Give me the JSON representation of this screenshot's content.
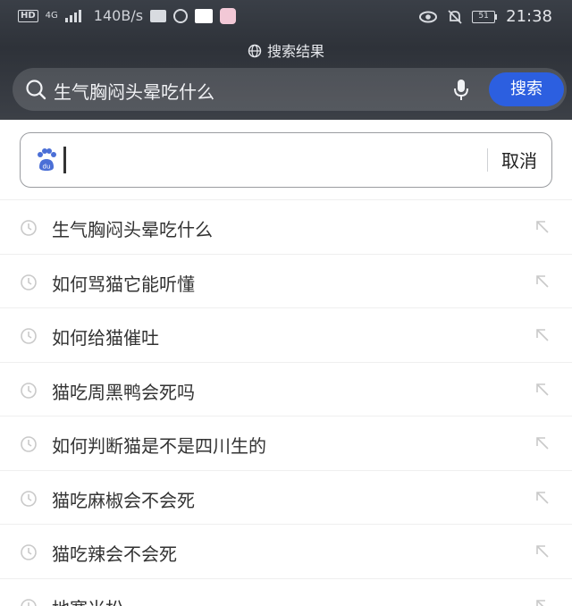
{
  "status_bar": {
    "network_hd": "HD",
    "network_gen": "4G",
    "speed": "140B/s",
    "battery": "51",
    "time": "21:38"
  },
  "page": {
    "results_label": "搜索结果",
    "search_query": "生气胸闷头晕吃什么",
    "search_button": "搜索"
  },
  "input": {
    "value": "",
    "cancel_label": "取消"
  },
  "history": [
    "生气胸闷头晕吃什么",
    "如何骂猫它能听懂",
    "如何给猫催吐",
    "猫吃周黑鸭会死吗",
    "如何判断猫是不是四川生的",
    "猫吃麻椒会不会死",
    "猫吃辣会不会死",
    "地塞米松"
  ],
  "colors": {
    "accent": "#2c5fe0",
    "header_bg": "#32363d"
  },
  "icons": [
    "signal-icon",
    "keyboard-icon",
    "netease-icon",
    "app-icon",
    "eye-icon",
    "mute-bell-icon",
    "battery-icon",
    "globe-icon",
    "search-icon",
    "mic-icon",
    "baidu-paw-icon",
    "clock-icon",
    "arrow-up-left-icon"
  ]
}
